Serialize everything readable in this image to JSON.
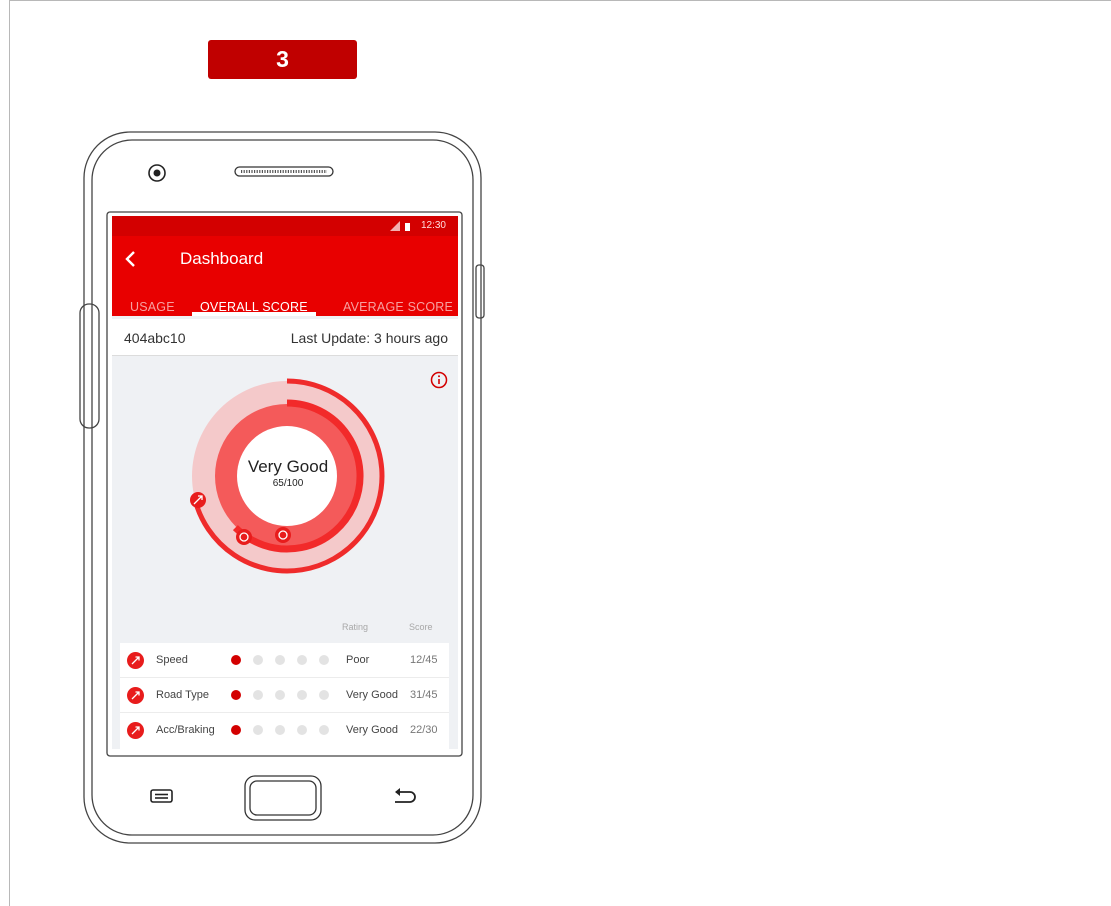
{
  "step": {
    "number": "3"
  },
  "status_bar": {
    "time": "12:30"
  },
  "app_bar": {
    "title": "Dashboard"
  },
  "tabs": [
    {
      "label": "USAGE",
      "active": false
    },
    {
      "label": "OVERALL SCORE",
      "active": true
    },
    {
      "label": "AVERAGE SCORE",
      "active": false
    }
  ],
  "info_row": {
    "vehicle_id": "404abc10",
    "last_update": "Last Update: 3 hours ago"
  },
  "score": {
    "label": "Very Good",
    "value": "65/100",
    "fraction": 0.65
  },
  "table": {
    "header_rating": "Rating",
    "header_score": "Score",
    "rows": [
      {
        "name": "Speed",
        "rating": "Poor",
        "score": "12/45",
        "level": 1
      },
      {
        "name": "Road Type",
        "rating": "Very Good",
        "score": "31/45",
        "level": 1
      },
      {
        "name": "Acc/Braking",
        "rating": "Very Good",
        "score": "22/30",
        "level": 1
      }
    ]
  },
  "colors": {
    "accent": "#e80000",
    "status": "#d30000",
    "badge": "#c00000"
  },
  "icons": {
    "back": "chevron-left-icon",
    "info": "info-icon",
    "metric": "trend-icon",
    "ring_markers": [
      "trend-icon",
      "steering-wheel-icon",
      "steering-wheel-icon"
    ]
  }
}
